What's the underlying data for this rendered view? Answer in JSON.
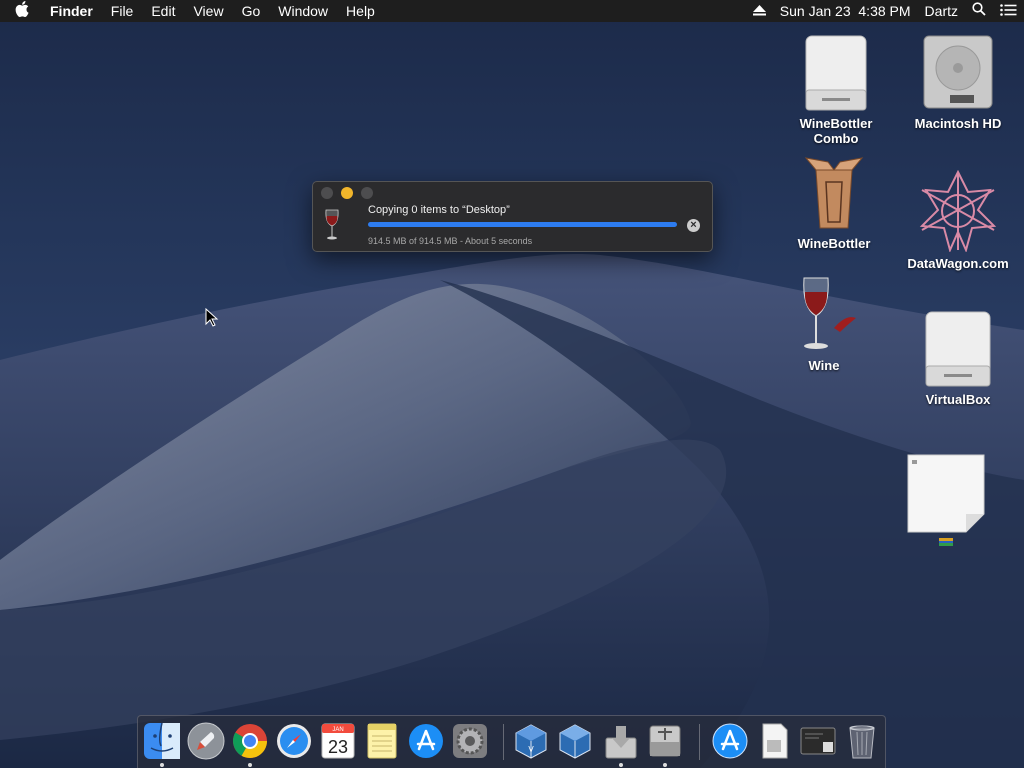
{
  "menubar": {
    "app": "Finder",
    "items": [
      "File",
      "Edit",
      "View",
      "Go",
      "Window",
      "Help"
    ],
    "datetime": "Sun Jan 23  4:38 PM",
    "user": "Dartz"
  },
  "desktop": {
    "icons": [
      {
        "label": "WineBottler Combo",
        "icon": "disk-image-icon"
      },
      {
        "label": "Macintosh HD",
        "icon": "hard-drive-icon"
      },
      {
        "label": "WineBottler",
        "icon": "box-icon"
      },
      {
        "label": "DataWagon.com",
        "icon": "snowflake-logo-icon"
      },
      {
        "label": "Wine",
        "icon": "wine-glass-icon"
      },
      {
        "label": "VirtualBox",
        "icon": "disk-image-icon"
      },
      {
        "label": "",
        "icon": "document-icon"
      }
    ]
  },
  "copy_dialog": {
    "title": "Copying 0 items to “Desktop”",
    "detail": "914.5 MB of 914.5 MB - About 5 seconds",
    "progress": 1.0,
    "cancel_symbol": "×"
  },
  "dock": {
    "apps": [
      {
        "name": "Finder",
        "running": true
      },
      {
        "name": "Launchpad",
        "running": false
      },
      {
        "name": "Chrome",
        "running": true
      },
      {
        "name": "Safari",
        "running": false
      },
      {
        "name": "Calendar",
        "running": false,
        "month": "JAN",
        "day": "23"
      },
      {
        "name": "Notes",
        "running": false
      },
      {
        "name": "App Store",
        "running": false
      },
      {
        "name": "System Preferences",
        "running": false
      },
      {
        "name": "VirtualBox",
        "running": false
      },
      {
        "name": "VirtualBox Extension",
        "running": false
      },
      {
        "name": "Installer",
        "running": true
      },
      {
        "name": "Disk Utility",
        "running": true
      },
      {
        "name": "App Store Downloads",
        "running": false
      },
      {
        "name": "Document",
        "running": false
      },
      {
        "name": "Terminal",
        "running": false
      },
      {
        "name": "Trash",
        "running": false
      }
    ]
  },
  "colors": {
    "accent": "#2d7cf0",
    "menubar": "#1e1e1e",
    "minimize": "#f1b52b"
  }
}
